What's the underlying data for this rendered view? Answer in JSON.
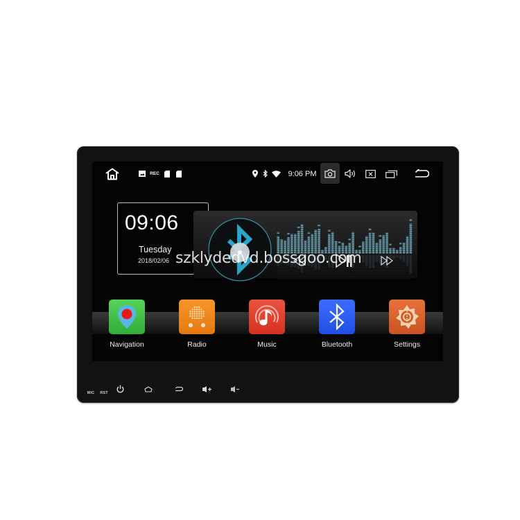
{
  "status_bar": {
    "left_icons": [
      "home-icon",
      "gallery-icon",
      "rec-icon",
      "sd-card-icon",
      "sd-card-icon"
    ],
    "rec_label": "REC",
    "right_icons": [
      "location-icon",
      "bluetooth-icon",
      "wifi-icon"
    ],
    "time": "9:06 PM",
    "actions": [
      "screenshot-icon",
      "volume-icon",
      "close-app-icon",
      "recent-apps-icon",
      "back-icon"
    ]
  },
  "clock_widget": {
    "time": "09:06",
    "day": "Tuesday",
    "date": "2018/02/06"
  },
  "music_widget": {
    "source_icon": "bluetooth-icon",
    "equalizer_levels": [
      0.55,
      0.45,
      0.42,
      0.52,
      0.62,
      0.62,
      0.72,
      0.92,
      0.42,
      0.55,
      0.62,
      0.75,
      0.78,
      0.12,
      0.22,
      0.62,
      0.68,
      0.4,
      0.25,
      0.35,
      0.25,
      0.35,
      0.68,
      0.12,
      0.12,
      0.38,
      0.55,
      0.66,
      0.66,
      0.35,
      0.45,
      0.58,
      0.66,
      0.18,
      0.18,
      0.12,
      0.22,
      0.35,
      0.55,
      0.95
    ],
    "controls": [
      "previous-icon",
      "play-pause-icon",
      "next-icon"
    ]
  },
  "apps": [
    {
      "label": "Navigation",
      "icon": "map-pin-icon",
      "color": "#3fbf3f"
    },
    {
      "label": "Radio",
      "icon": "radio-icon",
      "color": "#f08a1c"
    },
    {
      "label": "Music",
      "icon": "music-note-icon",
      "color": "#e0412f"
    },
    {
      "label": "Bluetooth",
      "icon": "bluetooth-icon",
      "color": "#2f5cf0"
    },
    {
      "label": "Settings",
      "icon": "settings-gear-icon",
      "color": "#d9662e"
    }
  ],
  "hardware_buttons": {
    "mic_label": "MIC",
    "rst_label": "RST",
    "buttons": [
      "power-icon",
      "home-icon",
      "back-icon",
      "volume-up-icon",
      "volume-down-icon"
    ]
  },
  "watermark": "szklydedvd.bossgoo.com",
  "colors": {
    "accent_cyan": "#2aa6c8",
    "eq_bar": "#5e8e9c",
    "bezel": "#121213"
  }
}
